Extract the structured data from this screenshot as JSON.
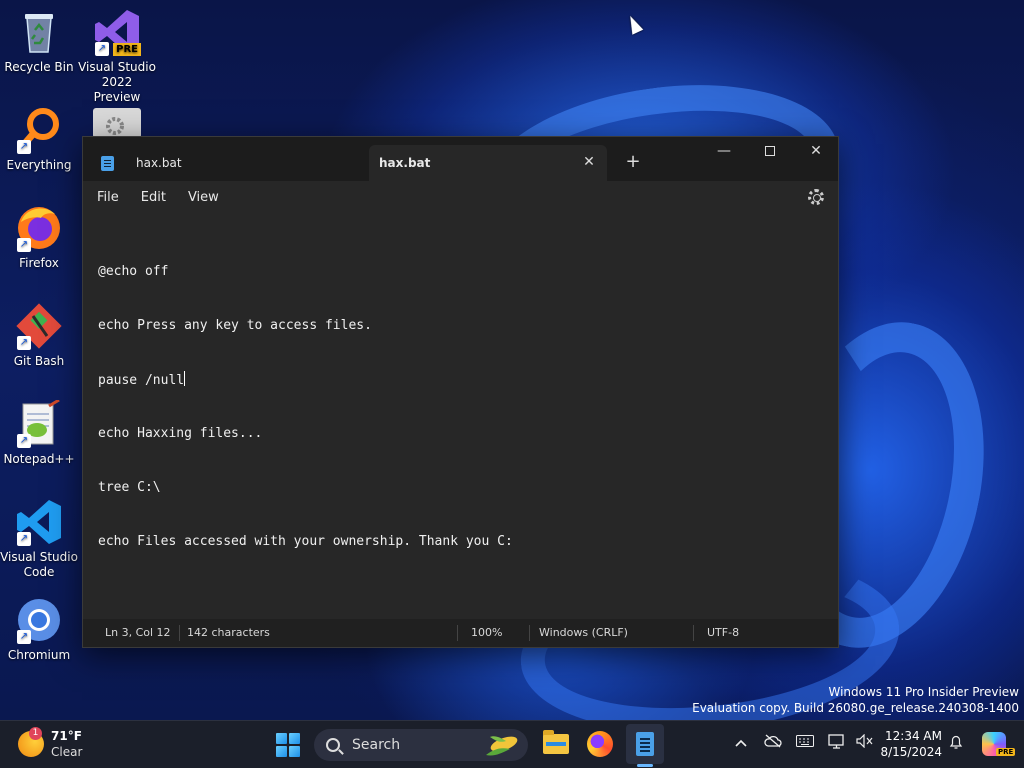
{
  "desktop": {
    "icons": [
      {
        "label": "Recycle Bin",
        "icon": "recycle-bin-icon"
      },
      {
        "label": "Visual Studio 2022 Preview",
        "icon": "visual-studio-icon",
        "badge": "PRE"
      },
      {
        "label": "Everything",
        "icon": "everything-search-icon"
      },
      {
        "label": "Firefox",
        "icon": "firefox-icon"
      },
      {
        "label": "Git Bash",
        "icon": "git-bash-icon"
      },
      {
        "label": "Notepad++",
        "icon": "notepad-plus-plus-icon"
      },
      {
        "label": "Visual Studio Code",
        "icon": "vscode-icon"
      },
      {
        "label": "Chromium",
        "icon": "chromium-icon"
      }
    ]
  },
  "notepad": {
    "tabs": [
      {
        "title": "hax.bat",
        "active": false
      },
      {
        "title": "hax.bat",
        "active": true
      }
    ],
    "close_glyph": "✕",
    "new_tab_glyph": "+",
    "minimize_glyph": "—",
    "close_window_glyph": "✕",
    "menu": {
      "file": "File",
      "edit": "Edit",
      "view": "View"
    },
    "lines": [
      "@echo off",
      "echo Press any key to access files.",
      "pause /null",
      "echo Haxxing files...",
      "tree C:\\",
      "echo Files accessed with your ownership. Thank you C:"
    ],
    "status": {
      "position": "Ln 3, Col 12",
      "characters": "142 characters",
      "zoom": "100%",
      "line_ending": "Windows (CRLF)",
      "encoding": "UTF-8"
    }
  },
  "watermark": {
    "line1": "Windows 11 Pro Insider Preview",
    "line2": "Evaluation copy. Build 26080.ge_release.240308-1400"
  },
  "taskbar": {
    "weather": {
      "badge": "1",
      "temp": "71°F",
      "condition": "Clear"
    },
    "search_label": "Search",
    "clock": {
      "time": "12:34 AM",
      "date": "8/15/2024"
    },
    "copilot_badge": "PRE"
  },
  "colors": {
    "accent": "#6ab8ff",
    "window_bg": "#272727",
    "titlebar_bg": "#1c1c1c"
  }
}
